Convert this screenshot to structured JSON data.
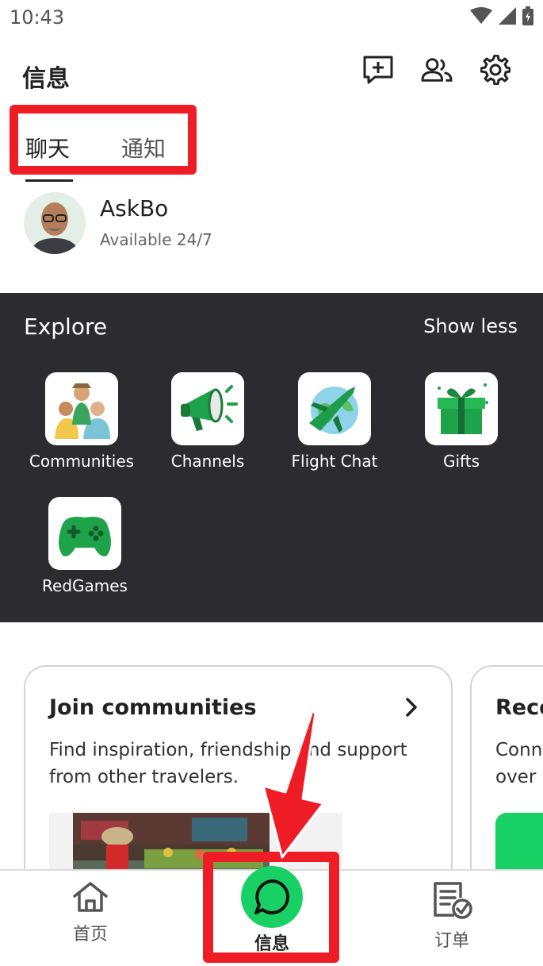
{
  "status_bar": {
    "time": "10:43"
  },
  "header": {
    "title": "信息",
    "actions": [
      "new-chat-icon",
      "contacts-icon",
      "settings-icon"
    ]
  },
  "tabs": [
    {
      "label": "聊天",
      "active": true
    },
    {
      "label": "通知",
      "active": false
    }
  ],
  "chat": {
    "name": "AskBo",
    "subtitle": "Available 24/7"
  },
  "explore": {
    "title": "Explore",
    "toggle_label": "Show less",
    "items": [
      {
        "label": "Communities",
        "icon": "communities-icon"
      },
      {
        "label": "Channels",
        "icon": "megaphone-icon"
      },
      {
        "label": "Flight Chat",
        "icon": "plane-globe-icon"
      },
      {
        "label": "Gifts",
        "icon": "gift-icon"
      },
      {
        "label": "RedGames",
        "icon": "gamepad-icon"
      }
    ]
  },
  "cards": [
    {
      "title": "Join communities",
      "description": "Find inspiration, friendship and support from other travelers."
    },
    {
      "title": "Reco",
      "description": "Conn over"
    }
  ],
  "bottom_nav": {
    "items": [
      {
        "label": "首页",
        "icon": "home-icon",
        "active": false
      },
      {
        "label": "信息",
        "icon": "chat-bubble-icon",
        "active": true
      },
      {
        "label": "订单",
        "icon": "orders-icon",
        "active": false
      }
    ]
  },
  "colors": {
    "accent_green": "#18d063",
    "annotation_red": "#ee1c25",
    "explore_bg": "#2b2b30"
  }
}
